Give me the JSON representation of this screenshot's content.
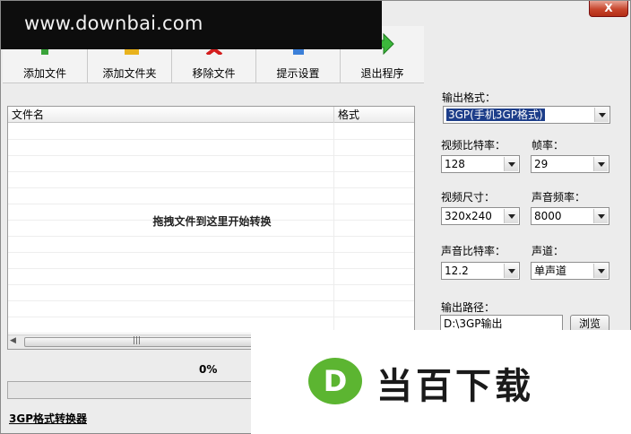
{
  "watermark": {
    "site": "www.downbai.com",
    "logo_text": "当百下载",
    "logo_letter": "D"
  },
  "window": {
    "close_label": "X"
  },
  "toolbar": {
    "items": [
      {
        "label": "添加文件",
        "icon": "add-file-icon"
      },
      {
        "label": "添加文件夹",
        "icon": "add-folder-icon"
      },
      {
        "label": "移除文件",
        "icon": "remove-file-icon"
      },
      {
        "label": "提示设置",
        "icon": "settings-icon"
      },
      {
        "label": "退出程序",
        "icon": "exit-arrow-icon"
      }
    ]
  },
  "file_list": {
    "columns": [
      "文件名",
      "格式"
    ],
    "drop_hint": "拖拽文件到这里开始转换",
    "scroll_grip": "|||"
  },
  "progress": {
    "value_text": "0%",
    "fraction": 0
  },
  "status": {
    "link_text": "3GP格式转换器"
  },
  "settings": {
    "output_format_label": "输出格式：",
    "output_format_value": "3GP(手机3GP格式)",
    "video_bitrate_label": "视频比特率：",
    "video_bitrate_value": "128",
    "framerate_label": "帧率：",
    "framerate_value": "29",
    "video_size_label": "视频尺寸：",
    "video_size_value": "320x240",
    "audio_samplerate_label": "声音频率：",
    "audio_samplerate_value": "8000",
    "audio_bitrate_label": "声音比特率：",
    "audio_bitrate_value": "12.2",
    "channel_label": "声道：",
    "channel_value": "单声道",
    "output_path_label": "输出路径：",
    "output_path_value": "D:\\3GP输出",
    "browse_label": "浏览"
  },
  "colors": {
    "selection": "#1d3e8a",
    "logo_green": "#5cb531",
    "close_red": "#c7452c"
  }
}
